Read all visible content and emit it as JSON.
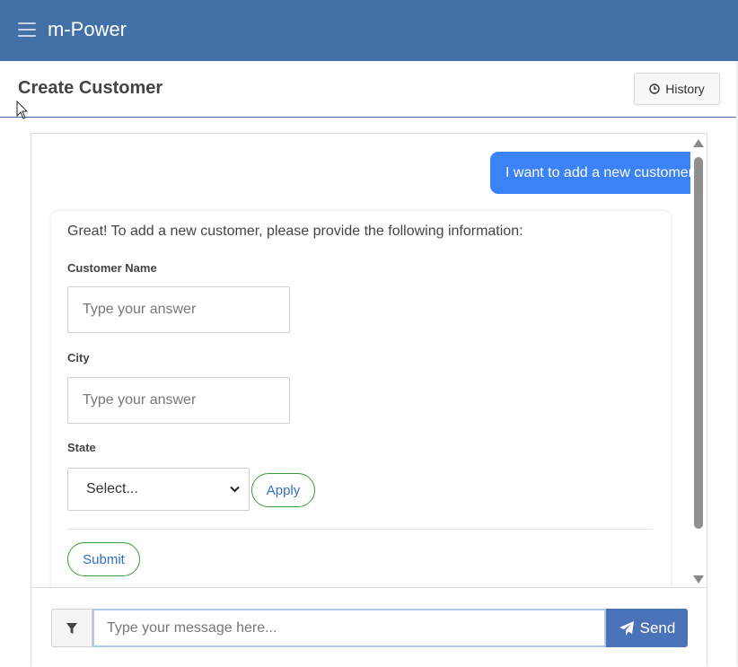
{
  "app": {
    "brand": "m-Power",
    "accent_color": "#4470a8"
  },
  "header": {
    "title": "Create Customer",
    "history_label": "History",
    "history_icon": "clock-icon"
  },
  "chat": {
    "user_message": "I want to add a new customer",
    "bot_intro": "Great! To add a new customer, please provide the following information:",
    "form": {
      "customer_name_label": "Customer Name",
      "customer_name_placeholder": "Type your answer",
      "city_label": "City",
      "city_placeholder": "Type your answer",
      "state_label": "State",
      "state_selected": "Select...",
      "apply_label": "Apply",
      "submit_label": "Submit"
    }
  },
  "composer": {
    "filter_icon": "filter-icon",
    "placeholder": "Type your message here...",
    "send_label": "Send",
    "send_icon": "paper-plane-icon"
  }
}
